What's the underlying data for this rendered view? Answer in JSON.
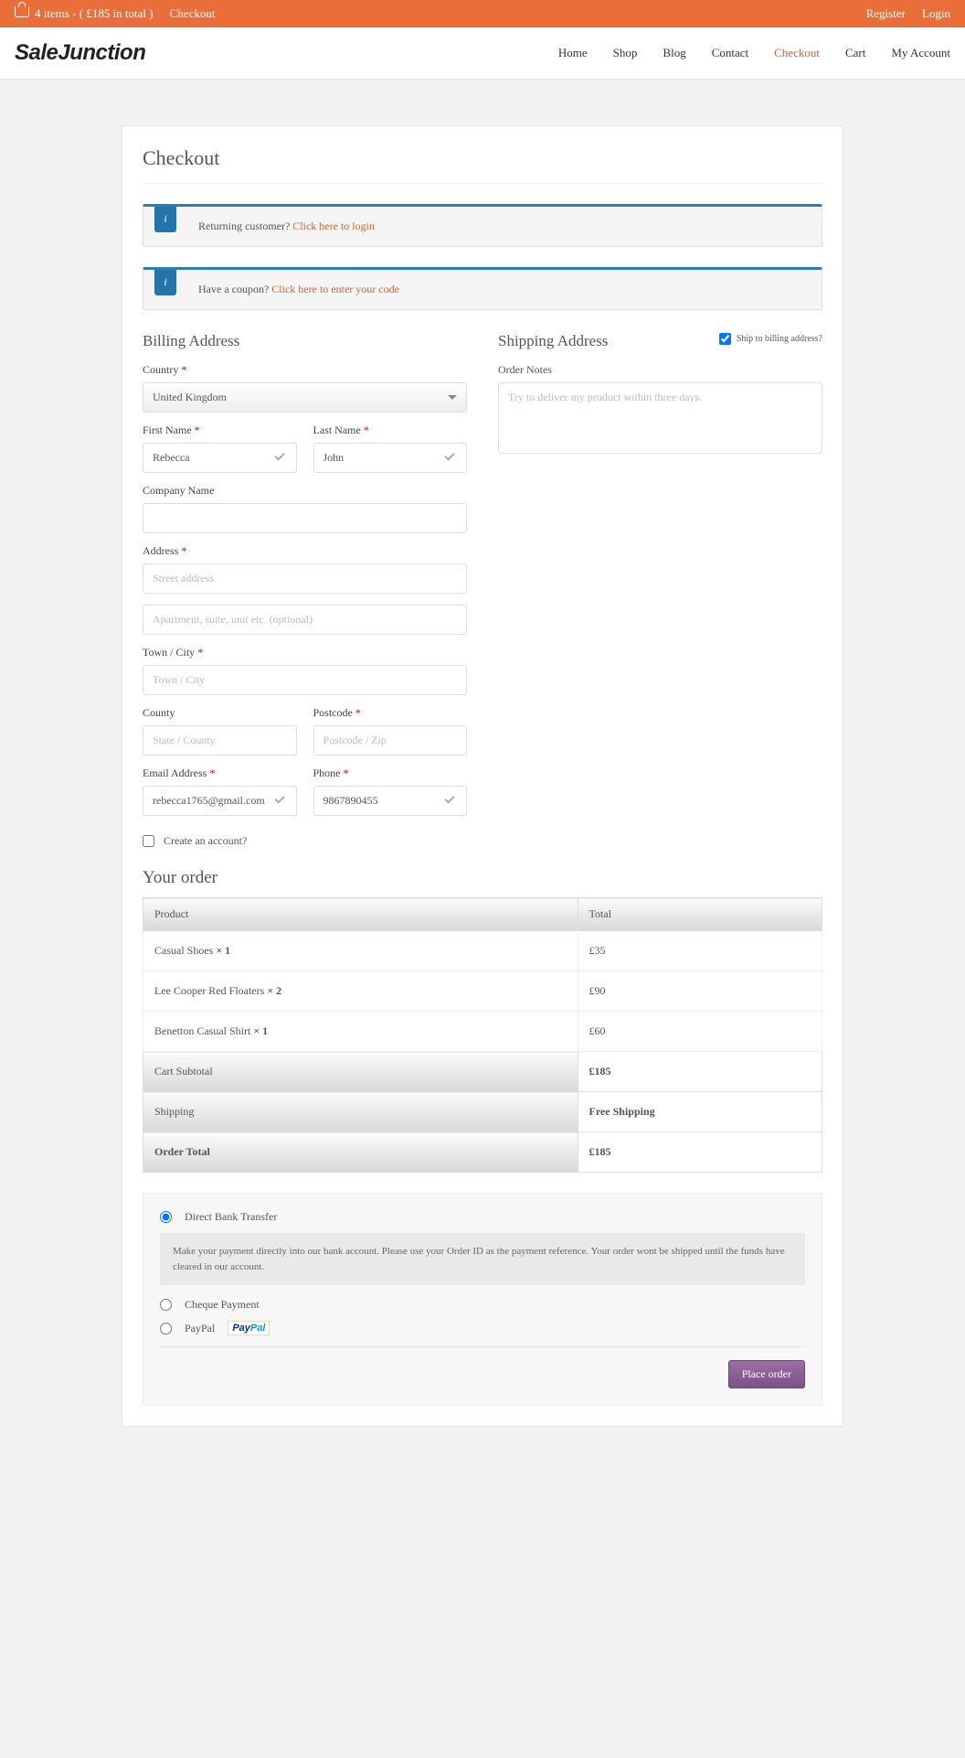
{
  "topbar": {
    "cart_summary": "4 items - ( £185 in total )",
    "checkout": "Checkout",
    "register": "Register",
    "login": "Login"
  },
  "logo": "SaleJunction",
  "nav": {
    "home": "Home",
    "shop": "Shop",
    "blog": "Blog",
    "contact": "Contact",
    "checkout": "Checkout",
    "cart": "Cart",
    "account": "My Account"
  },
  "page_title": "Checkout",
  "notices": {
    "returning_text": "Returning customer? ",
    "returning_link": "Click here to login",
    "coupon_text": "Have a coupon? ",
    "coupon_link": "Click here to enter your code"
  },
  "billing": {
    "heading": "Billing Address",
    "country_label": "Country",
    "country_value": "United Kingdom",
    "first_name_label": "First Name",
    "first_name_value": "Rebecca",
    "last_name_label": "Last Name",
    "last_name_value": "John",
    "company_label": "Company Name",
    "address_label": "Address",
    "address1_placeholder": "Street address",
    "address2_placeholder": "Apartment, suite, unit etc. (optional)",
    "town_label": "Town / City",
    "town_placeholder": "Town / City",
    "county_label": "County",
    "county_placeholder": "State / County",
    "postcode_label": "Postcode",
    "postcode_placeholder": "Postcode / Zip",
    "email_label": "Email Address",
    "email_value": "rebecca1765@gmail.com",
    "phone_label": "Phone",
    "phone_value": "9867890455",
    "create_account": "Create an account?"
  },
  "shipping": {
    "heading": "Shipping Address",
    "ship_to_billing": "Ship to billing address?",
    "notes_label": "Order Notes",
    "notes_placeholder": "Try to deliver my product within three days."
  },
  "order": {
    "heading": "Your order",
    "col_product": "Product",
    "col_total": "Total",
    "items": [
      {
        "name": "Casual Shoes",
        "qty": "× 1",
        "total": "£35"
      },
      {
        "name": "Lee Cooper Red Floaters",
        "qty": "× 2",
        "total": "£90"
      },
      {
        "name": "Benetton Casual Shirt",
        "qty": "× 1",
        "total": "£60"
      }
    ],
    "subtotal_label": "Cart Subtotal",
    "subtotal_value": "£185",
    "shipping_label": "Shipping",
    "shipping_value": "Free Shipping",
    "total_label": "Order Total",
    "total_value": "£185"
  },
  "payment": {
    "bank": "Direct Bank Transfer",
    "bank_desc": "Make your payment directly into our bank account. Please use your Order ID as the payment reference. Your order wont be shipped until the funds have cleared in our account.",
    "cheque": "Cheque Payment",
    "paypal": "PayPal",
    "place_order": "Place order"
  }
}
